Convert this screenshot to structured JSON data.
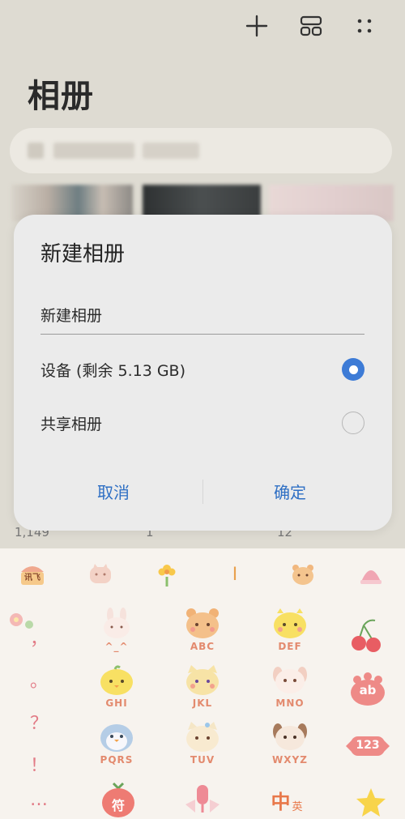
{
  "app": {
    "title": "相册",
    "counts": [
      "1,149",
      "1",
      "12"
    ]
  },
  "dialog": {
    "title": "新建相册",
    "input_value": "新建相册",
    "options": [
      {
        "label": "设备 (剩余 5.13 GB)",
        "selected": true
      },
      {
        "label": "共享相册",
        "selected": false
      }
    ],
    "cancel_label": "取消",
    "confirm_label": "确定"
  },
  "keyboard": {
    "toolbar_badge": "讯飞",
    "cursor_glyph": "I",
    "punctuation": [
      "，",
      "。",
      "？",
      "！",
      "…"
    ],
    "keys": [
      {
        "label": "^_^"
      },
      {
        "label": "ABC"
      },
      {
        "label": "DEF"
      },
      {
        "label": "GHI"
      },
      {
        "label": "JKL"
      },
      {
        "label": "MNO"
      },
      {
        "label": "PQRS"
      },
      {
        "label": "TUV"
      },
      {
        "label": "WXYZ"
      }
    ],
    "side_ab": "ab",
    "side_123": "123",
    "bottom_symbol": "符",
    "bottom_lang_main": "中",
    "bottom_lang_sub": "英"
  },
  "colors": {
    "accent": "#3d7bd6",
    "button_text": "#2e6fc4",
    "background": "#dedbd2",
    "dialog": "#ebebeb",
    "keyboard": "#f7f3ee"
  }
}
